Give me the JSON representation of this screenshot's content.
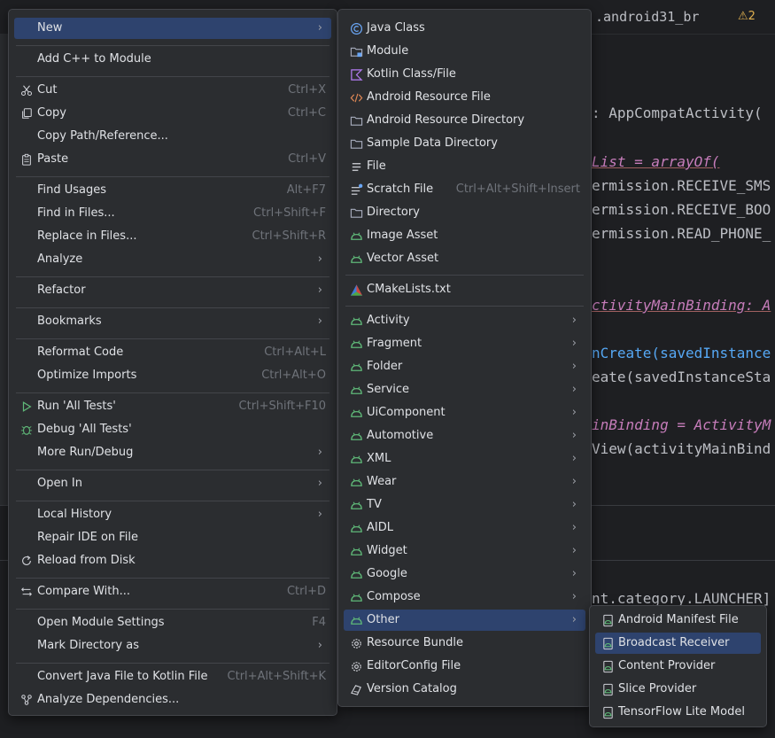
{
  "editor": {
    "tab_title": ".android31_br",
    "warning_count": "⚠2",
    "code_lines": [
      ": AppCompatActivity(",
      "List = arrayOf(",
      "ermission.RECEIVE_SMS",
      "ermission.RECEIVE_BOO",
      "ermission.READ_PHONE_",
      "ctivityMainBinding: A",
      "nCreate(savedInstance",
      "eate(savedInstanceSta",
      "inBinding = ActivityM",
      "View(activityMainBind",
      "nt.category.LAUNCHER]"
    ]
  },
  "main_menu": {
    "items": [
      {
        "label": "New",
        "mnemonic": "N"
      },
      {
        "label": "Add C++ to Module"
      },
      {
        "label": "Cut",
        "shortcut": "Ctrl+X"
      },
      {
        "label": "Copy",
        "shortcut": "Ctrl+C"
      },
      {
        "label": "Copy Path/Reference..."
      },
      {
        "label": "Paste",
        "shortcut": "Ctrl+V"
      },
      {
        "label": "Find Usages",
        "shortcut": "Alt+F7"
      },
      {
        "label": "Find in Files...",
        "shortcut": "Ctrl+Shift+F"
      },
      {
        "label": "Replace in Files...",
        "shortcut": "Ctrl+Shift+R"
      },
      {
        "label": "Analyze"
      },
      {
        "label": "Refactor"
      },
      {
        "label": "Bookmarks"
      },
      {
        "label": "Reformat Code",
        "shortcut": "Ctrl+Alt+L"
      },
      {
        "label": "Optimize Imports",
        "shortcut": "Ctrl+Alt+O"
      },
      {
        "label": "Run 'All Tests'",
        "shortcut": "Ctrl+Shift+F10"
      },
      {
        "label": "Debug 'All Tests'"
      },
      {
        "label": "More Run/Debug"
      },
      {
        "label": "Open In"
      },
      {
        "label": "Local History"
      },
      {
        "label": "Repair IDE on File"
      },
      {
        "label": "Reload from Disk"
      },
      {
        "label": "Compare With...",
        "shortcut": "Ctrl+D"
      },
      {
        "label": "Open Module Settings",
        "shortcut": "F4"
      },
      {
        "label": "Mark Directory as"
      },
      {
        "label": "Convert Java File to Kotlin File",
        "shortcut": "Ctrl+Alt+Shift+K"
      },
      {
        "label": "Analyze Dependencies..."
      }
    ]
  },
  "new_menu": {
    "items": [
      {
        "label": "Java Class",
        "icon": "java-class-icon"
      },
      {
        "label": "Module",
        "icon": "module-icon"
      },
      {
        "label": "Kotlin Class/File",
        "icon": "kotlin-icon"
      },
      {
        "label": "Android Resource File",
        "icon": "xml-resource-icon"
      },
      {
        "label": "Android Resource Directory",
        "icon": "folder-icon"
      },
      {
        "label": "Sample Data Directory",
        "icon": "folder-icon"
      },
      {
        "label": "File",
        "icon": "file-icon"
      },
      {
        "label": "Scratch File",
        "shortcut": "Ctrl+Alt+Shift+Insert",
        "icon": "scratch-file-icon"
      },
      {
        "label": "Directory",
        "icon": "folder-icon"
      },
      {
        "label": "Image Asset",
        "icon": "android-icon"
      },
      {
        "label": "Vector Asset",
        "icon": "android-icon"
      },
      {
        "label": "CMakeLists.txt",
        "icon": "cmake-icon"
      },
      {
        "label": "Activity",
        "icon": "android-icon"
      },
      {
        "label": "Fragment",
        "icon": "android-icon"
      },
      {
        "label": "Folder",
        "icon": "android-icon"
      },
      {
        "label": "Service",
        "icon": "android-icon"
      },
      {
        "label": "UiComponent",
        "icon": "android-icon"
      },
      {
        "label": "Automotive",
        "icon": "android-icon"
      },
      {
        "label": "XML",
        "icon": "android-icon"
      },
      {
        "label": "Wear",
        "icon": "android-icon"
      },
      {
        "label": "TV",
        "icon": "android-icon"
      },
      {
        "label": "AIDL",
        "icon": "android-icon"
      },
      {
        "label": "Widget",
        "icon": "android-icon"
      },
      {
        "label": "Google",
        "icon": "android-icon"
      },
      {
        "label": "Compose",
        "icon": "android-icon"
      },
      {
        "label": "Other",
        "icon": "android-icon"
      },
      {
        "label": "Resource Bundle",
        "icon": "gear-icon"
      },
      {
        "label": "EditorConfig File",
        "icon": "gear-icon"
      },
      {
        "label": "Version Catalog",
        "icon": "catalog-icon"
      }
    ]
  },
  "other_menu": {
    "items": [
      {
        "label": "Android Manifest File"
      },
      {
        "label": "Broadcast Receiver"
      },
      {
        "label": "Content Provider"
      },
      {
        "label": "Slice Provider"
      },
      {
        "label": "TensorFlow Lite Model"
      }
    ]
  },
  "colors": {
    "menu_bg": "#2b2d30",
    "selection": "#2e436e",
    "android_green": "#5fb878",
    "shortcut_gray": "#6f737a"
  }
}
